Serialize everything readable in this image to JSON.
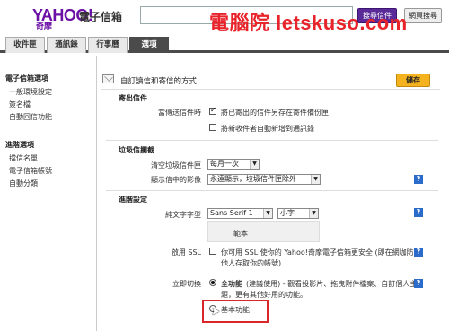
{
  "header": {
    "logo": "YAHOO!",
    "logo_sub": "奇摩",
    "service": "電子信箱",
    "search_value": "",
    "search_mail_button": "搜尋信件",
    "search_web_button": "網頁搜尋",
    "watermark": "電腦院 letskuso.com"
  },
  "tabs": [
    {
      "label": "收件匣"
    },
    {
      "label": "通訊錄"
    },
    {
      "label": "行事曆"
    },
    {
      "label": "選項"
    }
  ],
  "sidebar": {
    "section1_title": "電子信箱選項",
    "section1_items": [
      "一般環境設定",
      "簽名檔",
      "自動回信功能"
    ],
    "section2_title": "進階選項",
    "section2_items": [
      "擋信名單",
      "電子信箱帳號",
      "自動分類"
    ]
  },
  "main": {
    "title": "自訂讀信和寄信的方式",
    "save_button": "儲存",
    "outgoing": {
      "title": "寄出信件",
      "label": "當傳送信件時",
      "option1": "將已寄出的信件另存在寄件備份匣",
      "option1_checked": true,
      "option2": "將新收件者自動新增到通訊錄",
      "option2_checked": false
    },
    "spam": {
      "title": "垃圾信攔截",
      "clear_label": "清空垃圾信件匣",
      "clear_value": "每月一次",
      "images_label": "顯示信中的影像",
      "images_value": "永遠顯示，垃圾信件匣除外"
    },
    "advanced": {
      "title": "進階設定",
      "font_label": "純文字字型",
      "font_value": "Sans Serif 1",
      "size_value": "小字",
      "preview_text": "範本",
      "ssl_label": "啟用 SSL",
      "ssl_text_line1": "你可用 SSL 使你的 Yahoo!奇摩電子信箱更安全 (即在網咖防止",
      "ssl_text_line2": "他人存取你的帳號)",
      "switch_label": "立即切換",
      "full_label": "全功能",
      "full_desc_line1": "(建議使用) - 觀看投影片、拖曳附件檔案、自訂個人主",
      "full_desc_line2": "題，更有其他好用的功能。",
      "basic_label": "基本功能"
    }
  }
}
